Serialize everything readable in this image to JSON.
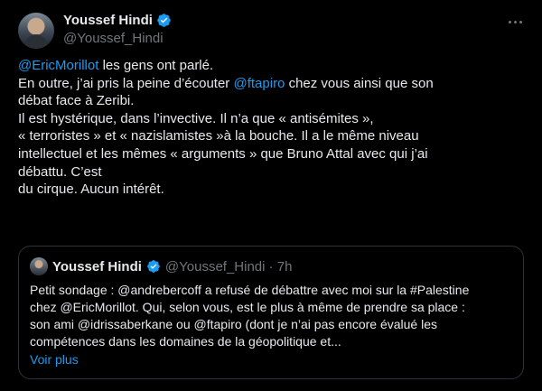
{
  "author": {
    "name": "Youssef Hindi",
    "handle": "@Youssef_Hindi"
  },
  "tweet": {
    "line1_mention": "@EricMorillot",
    "line1_rest": " les gens ont parlé.",
    "line2_pre": "En outre, j’ai pris la peine d’écouter ",
    "line2_mention": "@ftapiro",
    "line2_post": " chez vous ainsi que son",
    "line3": "débat face à Zeribi.",
    "line4": "Il est hystérique, dans l’invective. Il n’a que « antisémites »,",
    "line5": "« terroristes » et « nazislamistes »à la bouche. Il a le même niveau",
    "line6": "intellectuel et les mêmes « arguments » que Bruno Attal avec qui j’ai",
    "line7": "débattu. C’est",
    "line8": "du cirque. Aucun intérêt."
  },
  "quoted": {
    "name": "Youssef Hindi",
    "meta": "@Youssef_Hindi · 7h",
    "line1": "Petit sondage : @andrebercoff a refusé de débattre avec moi sur la #Palestine",
    "line2": "chez @EricMorillot. Qui, selon vous, est le plus à même de prendre sa place :",
    "line3": "son ami @idrissaberkane ou @ftapiro (dont je n’ai pas encore évalué les",
    "line4": "compétences dans les domaines de la géopolitique et...",
    "show_more": "Voir plus"
  },
  "colors": {
    "background": "#000000",
    "text": "#e7e9ea",
    "muted": "#71767b",
    "link": "#1d9bf0",
    "border": "#2f3336"
  },
  "icons": [
    "verified-badge-icon",
    "more-options-icon"
  ]
}
